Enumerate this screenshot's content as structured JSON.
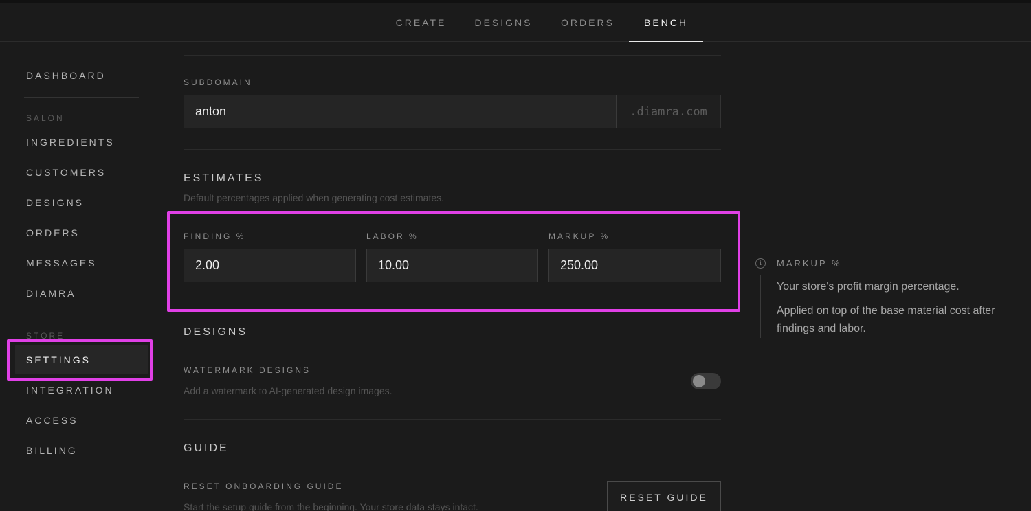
{
  "topnav": {
    "tabs": [
      {
        "label": "CREATE"
      },
      {
        "label": "DESIGNS"
      },
      {
        "label": "ORDERS"
      },
      {
        "label": "BENCH",
        "active": true
      }
    ]
  },
  "sidebar": {
    "dashboard": "DASHBOARD",
    "section_salon": "SALON",
    "ingredients": "INGREDIENTS",
    "customers": "CUSTOMERS",
    "designs": "DESIGNS",
    "orders": "ORDERS",
    "messages": "MESSAGES",
    "diamra": "DIAMRA",
    "section_store": "STORE",
    "settings": "SETTINGS",
    "integration": "INTEGRATION",
    "access": "ACCESS",
    "billing": "BILLING"
  },
  "subdomain": {
    "label": "SUBDOMAIN",
    "value": "anton",
    "suffix": ".diamra.com"
  },
  "estimates": {
    "title": "ESTIMATES",
    "description": "Default percentages applied when generating cost estimates.",
    "finding_label": "FINDING %",
    "finding_value": "2.00",
    "labor_label": "LABOR %",
    "labor_value": "10.00",
    "markup_label": "MARKUP %",
    "markup_value": "250.00"
  },
  "designs": {
    "title": "DESIGNS",
    "watermark_label": "WATERMARK DESIGNS",
    "watermark_desc": "Add a watermark to AI-generated design images.",
    "watermark_enabled": false
  },
  "guide": {
    "title": "GUIDE",
    "reset_label": "RESET ONBOARDING GUIDE",
    "reset_desc": "Start the setup guide from the beginning. Your store data stays intact.",
    "reset_button": "RESET GUIDE"
  },
  "info_panel": {
    "icon": "info-icon",
    "title": "MARKUP %",
    "line1": "Your store's profit margin percentage.",
    "line2": "Applied on top of the base material cost after findings and labor."
  },
  "colors": {
    "highlight": "#e040e6",
    "background": "#1b1b1b"
  }
}
